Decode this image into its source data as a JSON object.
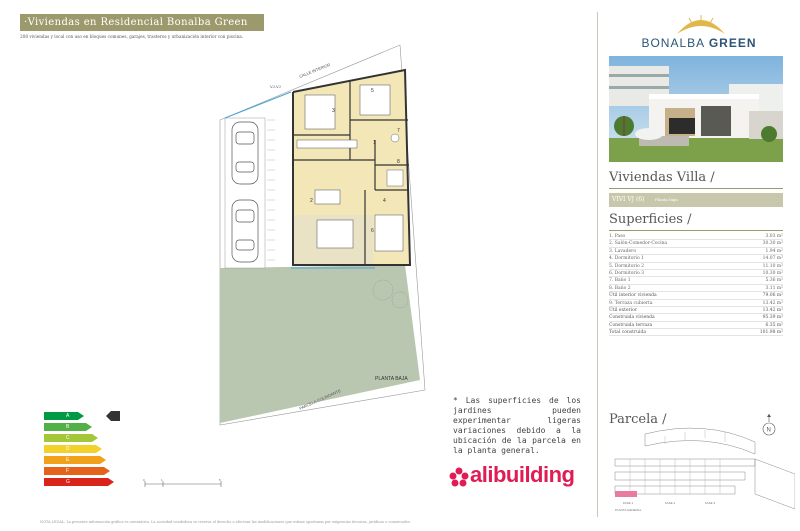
{
  "header": {
    "title": "Viviendas en Residencial Bonalba Green",
    "intro": "208 viviendas y local con uso en bloques comunes, garajes, trasteros y urbanización interior con piscina."
  },
  "plan": {
    "calle_label": "CALLE INTERIOR",
    "vp_label": "VJ-VJ",
    "planta_label": "PLANTA BAJA",
    "parcela_label": "PARCELA COLINDANTE",
    "rooms": [
      "1",
      "2",
      "3",
      "4",
      "5",
      "6",
      "7",
      "8"
    ]
  },
  "energy": {
    "classes": [
      "A",
      "B",
      "C",
      "D",
      "E",
      "F",
      "G"
    ],
    "colors": [
      "#009a44",
      "#52b047",
      "#a4c639",
      "#f2d12a",
      "#f2a11a",
      "#e5621a",
      "#d9241c"
    ],
    "pointer_class": "A"
  },
  "note": "* Las superficies de los jardines pueden experimentar ligeras variaciones debido a la ubicación de la parcela en la planta general.",
  "scale": {
    "labels": [
      "0",
      "1",
      "5"
    ]
  },
  "brand": {
    "name": "alibuilding",
    "color": "#e01c54"
  },
  "footer": "NOTA LEGAL: La presente información gráfica es orientativa. La sociedad vendedora se reserva el derecho a efectuar las modificaciones que estime oportunas por exigencias técnicas, jurídicas o comerciales.",
  "logo": {
    "name_light": "BONALBA",
    "name_bold": "GREEN",
    "color": "#2c5476",
    "sun_color": "#e0b84a"
  },
  "type": {
    "title": "Viviendas Villa /",
    "code": "VIVI VJ (6)",
    "right": "Planta baja"
  },
  "superficies": {
    "title": "Superficies /",
    "rows": [
      {
        "label": "1. Paso",
        "value": "3.03 m²"
      },
      {
        "label": "2. Salón-Comedor-Cocina",
        "value": "30.30 m²"
      },
      {
        "label": "3. Lavadero",
        "value": "1.94 m²"
      },
      {
        "label": "4. Dormitorio 1",
        "value": "14.07 m²"
      },
      {
        "label": "5. Dormitorio 2",
        "value": "11.10 m²"
      },
      {
        "label": "6. Dormitorio 3",
        "value": "10.30 m²"
      },
      {
        "label": "7. Baño 1",
        "value": "5.36 m²"
      },
      {
        "label": "8. Baño 2",
        "value": "3.11 m²"
      },
      {
        "label": "Útil interior vivienda",
        "value": "79.06 m²"
      },
      {
        "label": "9. Terraza cubierta",
        "value": "13.42 m²"
      },
      {
        "label": "Útil exterior",
        "value": "13.42 m²"
      },
      {
        "label": "Construida vivienda",
        "value": "95.39 m²"
      },
      {
        "label": "Construida terraza",
        "value": "6.35 m²"
      },
      {
        "label": "Total construida",
        "value": "101.98 m²"
      }
    ]
  },
  "parcela": {
    "title": "Parcela /",
    "north": "N",
    "labels": [
      "FASE 1",
      "FASE 2",
      "FASE 3",
      "PLANTA GENERAL"
    ],
    "highlight_color": "#e97aa0"
  }
}
